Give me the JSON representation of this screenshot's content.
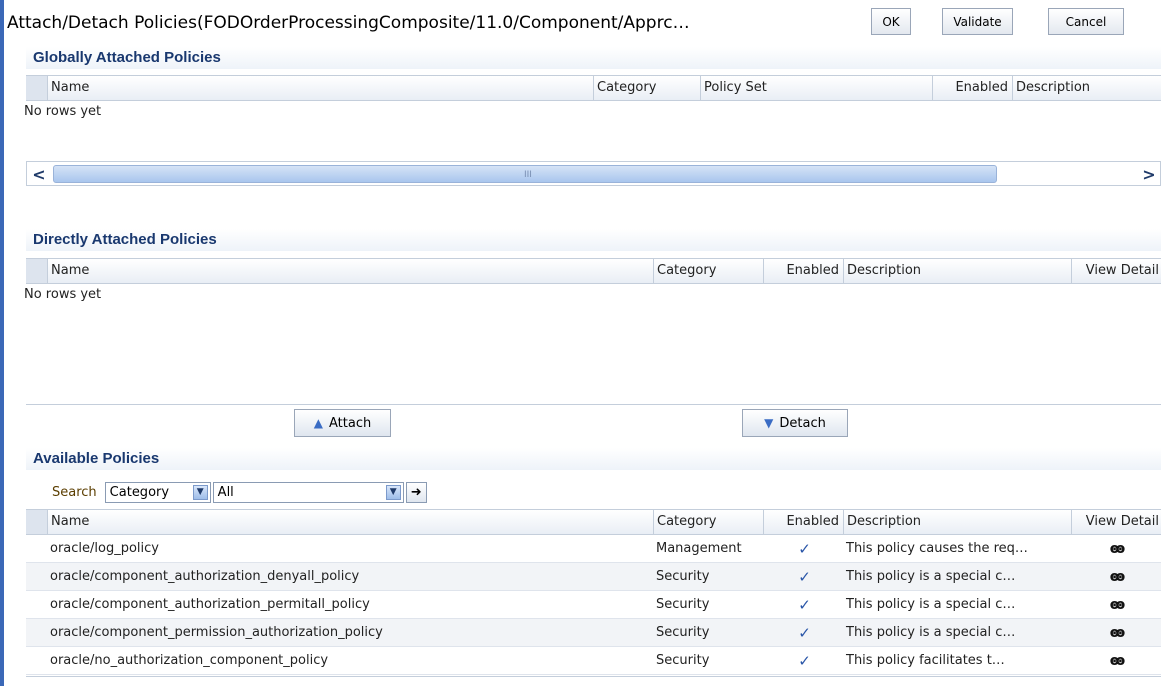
{
  "header": {
    "title": "Attach/Detach Policies(FODOrderProcessingComposite/11.0/Component/Apprc…",
    "ok_label": "OK",
    "validate_label": "Validate",
    "cancel_label": "Cancel"
  },
  "global": {
    "title": "Globally Attached Policies",
    "columns": [
      "Name",
      "Category",
      "Policy Set",
      "Enabled",
      "Description"
    ],
    "empty_text": "No rows yet",
    "scroll_left": "<",
    "scroll_right": ">",
    "scroll_grip": "III"
  },
  "direct": {
    "title": "Directly Attached Policies",
    "columns": [
      "Name",
      "Category",
      "Enabled",
      "Description",
      "View Detail"
    ],
    "empty_text": "No rows yet",
    "attach_label": "Attach",
    "detach_label": "Detach"
  },
  "available": {
    "title": "Available Policies",
    "search_label": "Search",
    "filter_field": "Category",
    "filter_value": "All",
    "go_icon": "➜",
    "columns": [
      "Name",
      "Category",
      "Enabled",
      "Description",
      "View Detail"
    ],
    "rows": [
      {
        "name": "oracle/log_policy",
        "category": "Management",
        "enabled": "✓",
        "description": "This policy causes the req…",
        "view": "ꙭ"
      },
      {
        "name": "oracle/component_authorization_denyall_policy",
        "category": "Security",
        "enabled": "✓",
        "description": "This policy is a special c…",
        "view": "ꙭ"
      },
      {
        "name": "oracle/component_authorization_permitall_policy",
        "category": "Security",
        "enabled": "✓",
        "description": "This policy is a special c…",
        "view": "ꙭ"
      },
      {
        "name": "oracle/component_permission_authorization_policy",
        "category": "Security",
        "enabled": "✓",
        "description": "This policy is a special c…",
        "view": "ꙭ"
      },
      {
        "name": "oracle/no_authorization_component_policy",
        "category": "Security",
        "enabled": "✓",
        "description": "This policy facilitates t…",
        "view": "ꙭ"
      }
    ]
  },
  "colors": {
    "accent": "#3b68b7",
    "section_title": "#19386f"
  }
}
